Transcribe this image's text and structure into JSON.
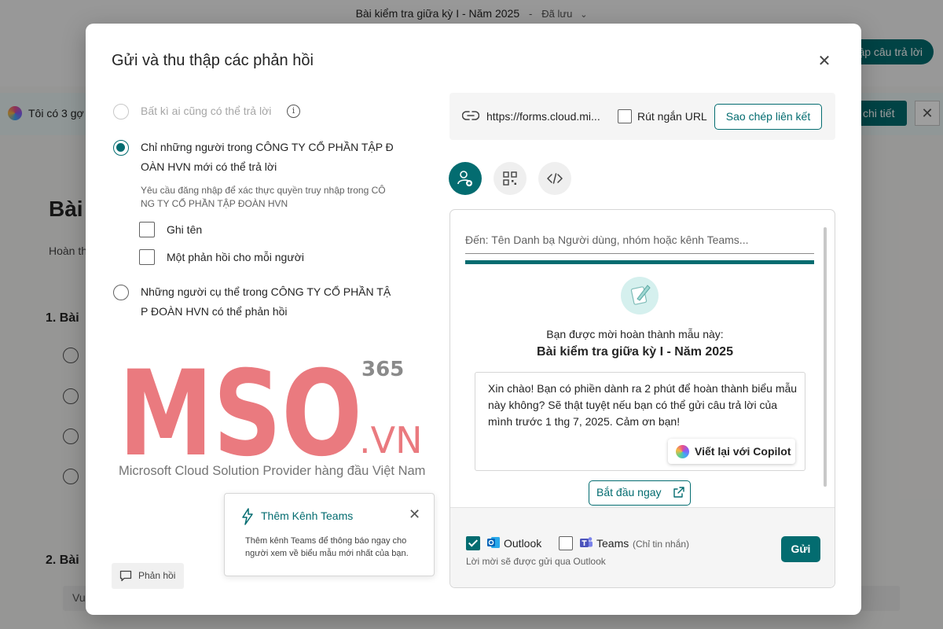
{
  "background": {
    "doc_title": "Bài kiểm tra giữa kỳ I - Năm 2025",
    "doc_separator": "-",
    "saved_status": "Đã lưu",
    "collect_button": "ập câu trả lời",
    "banner_text": "Tôi có 3 gợ",
    "detail_button": "chi tiết",
    "heading": "Bài",
    "subtitle": "Hoàn th",
    "question_1": "1. Bài",
    "question_2": "2. Bài",
    "input_placeholder": "Vu"
  },
  "modal": {
    "title": "Gửi và thu thập các phản hồi",
    "close_label": "✕",
    "options": {
      "anyone": "Bất kì ai cũng có thể trả lời",
      "org_only": "Chỉ những người trong CÔNG TY CỔ PHẦN TẬP Đ OÀN HVN mới có thể trả lời",
      "org_hint": "Yêu cầu đăng nhập để xác thực quyền truy nhập trong CÔ NG TY CỔ PHẦN TẬP ĐOÀN HVN",
      "record_name": "Ghi tên",
      "one_response": "Một phản hồi cho mỗi người",
      "specific_people": "Những người cụ thể trong CÔNG TY CỔ PHẦN TẬ P ĐOÀN HVN có thể phản hồi"
    },
    "watermark": {
      "brand": "MSO",
      "superscript": "365",
      "domain": ".VN",
      "tagline": "Microsoft Cloud Solution Provider hàng đầu Việt Nam"
    },
    "teams_tip": {
      "title": "Thêm Kênh Teams",
      "body": "Thêm kênh Teams để thông báo ngay cho người xem về biểu mẫu mới nhất của bạn."
    },
    "feedback_button": "Phản hồi",
    "link": {
      "url": "https://forms.cloud.mi...",
      "shorten_label": "Rút ngắn URL",
      "copy_button": "Sao chép liên kết"
    },
    "email": {
      "to_placeholder": "Đến: Tên Danh bạ Người dùng, nhóm hoặc kênh Teams...",
      "invite_line": "Bạn được mời hoàn thành mẫu này:",
      "form_title": "Bài kiểm tra giữa kỳ I - Năm 2025",
      "message": "Xin chào! Bạn có phiền dành ra 2 phút để hoàn thành biểu mẫu này không? Sẽ thật tuyệt nếu bạn có thể gửi câu trả lời của mình trước 1 thg 7, 2025. Cảm ơn bạn!",
      "copilot_button": "Viết lại với Copilot",
      "start_button": "Bắt đầu ngay",
      "outlook_label": "Outlook",
      "teams_label": "Teams",
      "teams_note": "(Chỉ tin nhắn)",
      "send_note": "Lời mời sẽ được gửi qua Outlook",
      "send_button": "Gửi"
    }
  },
  "colors": {
    "accent": "#036c70",
    "logo": "#ea7a7f"
  }
}
